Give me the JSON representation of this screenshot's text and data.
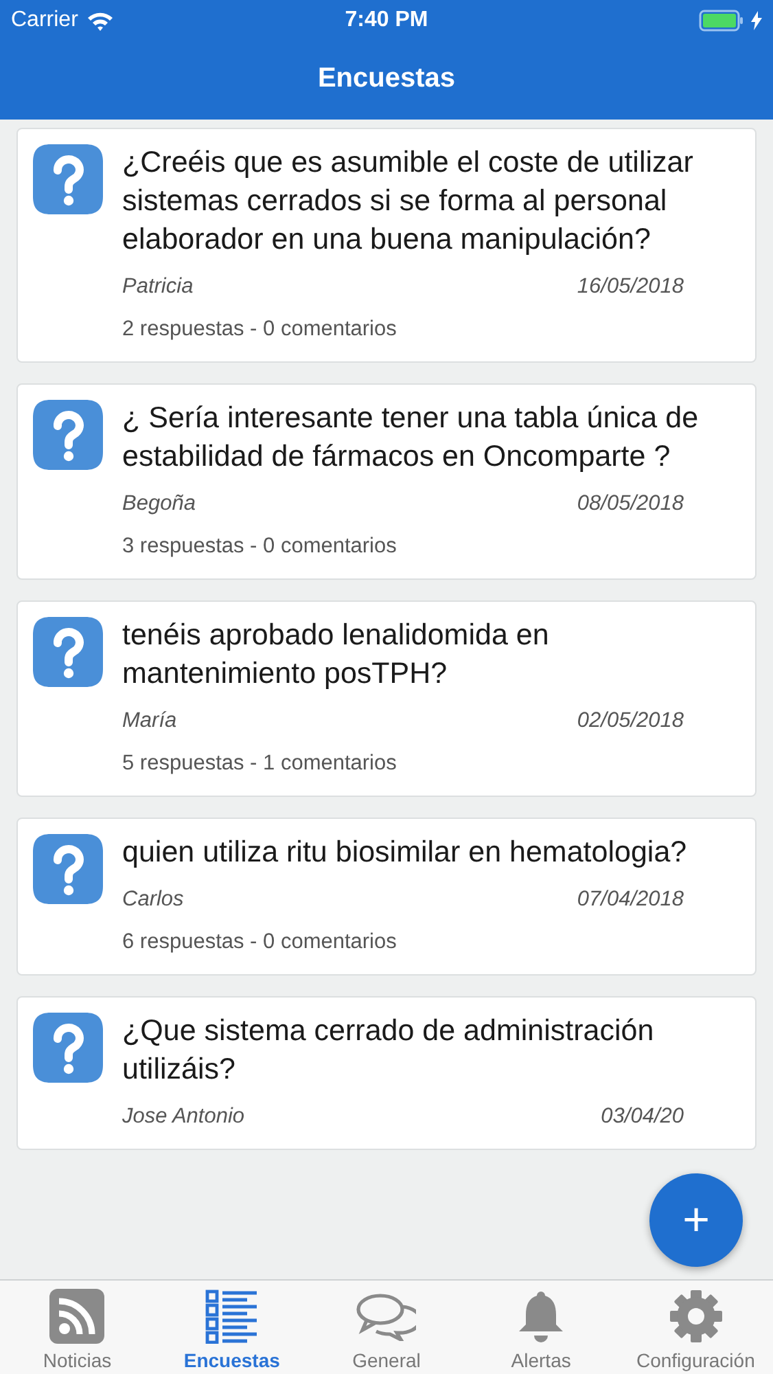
{
  "status_bar": {
    "carrier": "Carrier",
    "time": "7:40 PM"
  },
  "nav_bar": {
    "title": "Encuestas"
  },
  "surveys": [
    {
      "question": "¿Creéis que es asumible el coste de utilizar sistemas cerrados si se forma al personal elaborador en una buena manipulación?",
      "author": "Patricia",
      "date": "16/05/2018",
      "stats": "2 respuestas - 0 comentarios"
    },
    {
      "question": "¿ Sería interesante tener una tabla única de estabilidad de fármacos en Oncomparte ?",
      "author": "Begoña",
      "date": "08/05/2018",
      "stats": "3 respuestas - 0 comentarios"
    },
    {
      "question": "tenéis aprobado lenalidomida en mantenimiento posTPH?",
      "author": "María",
      "date": "02/05/2018",
      "stats": "5 respuestas - 1 comentarios"
    },
    {
      "question": "quien utiliza ritu biosimilar en hematologia?",
      "author": " Carlos",
      "date": "07/04/2018",
      "stats": "6 respuestas - 0 comentarios"
    },
    {
      "question": "¿Que sistema cerrado de administración utilizáis?",
      "author": "Jose Antonio",
      "date": "03/04/20"
    }
  ],
  "fab": {
    "label": "+"
  },
  "tab_bar": [
    {
      "kind": "rss",
      "label": "Noticias",
      "selected": false
    },
    {
      "kind": "list",
      "label": "Encuestas",
      "selected": true
    },
    {
      "kind": "chat",
      "label": "General",
      "selected": false
    },
    {
      "kind": "bell",
      "label": "Alertas",
      "selected": false
    },
    {
      "kind": "gear",
      "label": "Configuración",
      "selected": false
    }
  ]
}
